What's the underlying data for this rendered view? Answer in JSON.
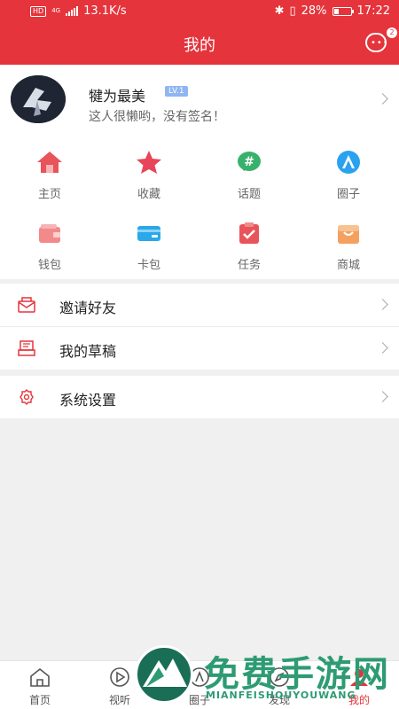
{
  "status_bar": {
    "network_badge": "HD",
    "network_type": "4G",
    "speed": "13.1K/s",
    "battery": "28%",
    "time": "17:22"
  },
  "header": {
    "title": "我的",
    "message_icon": "chat-bubble-icon",
    "message_badge": "2",
    "background_color": "#e5343b"
  },
  "profile": {
    "username": "犍为最美",
    "level": "LV.1",
    "signature": "这人很懒哟，没有签名！"
  },
  "grid": [
    {
      "label": "主页",
      "icon": "home-icon",
      "color": "#e8545a"
    },
    {
      "label": "收藏",
      "icon": "star-icon",
      "color": "#e8455a"
    },
    {
      "label": "话题",
      "icon": "hashtag-icon",
      "color": "#37b26c"
    },
    {
      "label": "圈子",
      "icon": "circle-a-icon",
      "color": "#2aa2f0"
    },
    {
      "label": "钱包",
      "icon": "wallet-icon",
      "color": "#f28a8a"
    },
    {
      "label": "卡包",
      "icon": "card-icon",
      "color": "#29a8ea"
    },
    {
      "label": "任务",
      "icon": "task-icon",
      "color": "#e8545a"
    },
    {
      "label": "商城",
      "icon": "shop-icon",
      "color": "#f5a060"
    }
  ],
  "menu": [
    {
      "label": "邀请好友",
      "icon": "invite-icon"
    },
    {
      "label": "我的草稿",
      "icon": "draft-icon"
    },
    {
      "label": "系统设置",
      "icon": "settings-icon"
    }
  ],
  "tabbar": [
    {
      "label": "首页",
      "icon": "home-tab-icon",
      "active": false
    },
    {
      "label": "视听",
      "icon": "play-tab-icon",
      "active": false
    },
    {
      "label": "圈子",
      "icon": "circle-tab-icon",
      "active": false
    },
    {
      "label": "发现",
      "icon": "discover-tab-icon",
      "active": false
    },
    {
      "label": "我的",
      "icon": "me-tab-icon",
      "active": true
    }
  ],
  "watermark": {
    "title": "免费手游网",
    "subtitle": "MIANFEISHOUYOUWANG"
  }
}
